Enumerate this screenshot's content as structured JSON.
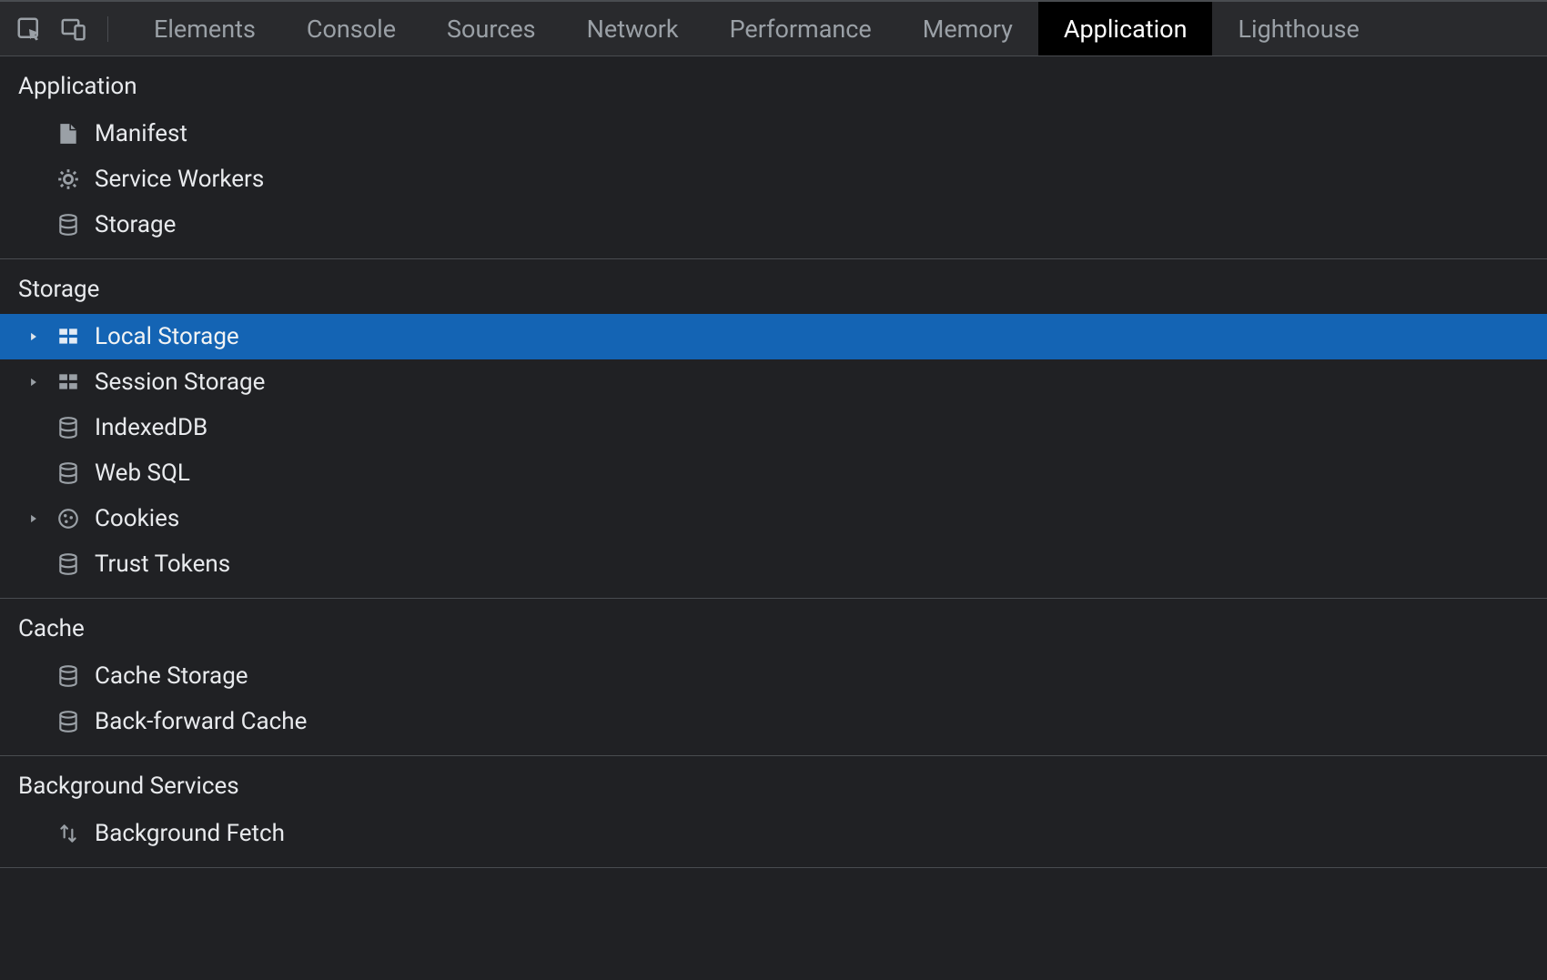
{
  "tabs": [
    {
      "id": "elements",
      "label": "Elements",
      "active": false
    },
    {
      "id": "console",
      "label": "Console",
      "active": false
    },
    {
      "id": "sources",
      "label": "Sources",
      "active": false
    },
    {
      "id": "network",
      "label": "Network",
      "active": false
    },
    {
      "id": "performance",
      "label": "Performance",
      "active": false
    },
    {
      "id": "memory",
      "label": "Memory",
      "active": false
    },
    {
      "id": "application",
      "label": "Application",
      "active": true
    },
    {
      "id": "lighthouse",
      "label": "Lighthouse",
      "active": false
    }
  ],
  "sections": [
    {
      "id": "application",
      "title": "Application",
      "items": [
        {
          "id": "manifest",
          "label": "Manifest",
          "icon": "file",
          "expandable": false,
          "selected": false
        },
        {
          "id": "service-workers",
          "label": "Service Workers",
          "icon": "gear",
          "expandable": false,
          "selected": false
        },
        {
          "id": "storage",
          "label": "Storage",
          "icon": "database",
          "expandable": false,
          "selected": false
        }
      ]
    },
    {
      "id": "storage",
      "title": "Storage",
      "items": [
        {
          "id": "local-storage",
          "label": "Local Storage",
          "icon": "grid",
          "expandable": true,
          "selected": true
        },
        {
          "id": "session-storage",
          "label": "Session Storage",
          "icon": "grid",
          "expandable": true,
          "selected": false
        },
        {
          "id": "indexeddb",
          "label": "IndexedDB",
          "icon": "database",
          "expandable": false,
          "selected": false
        },
        {
          "id": "websql",
          "label": "Web SQL",
          "icon": "database",
          "expandable": false,
          "selected": false
        },
        {
          "id": "cookies",
          "label": "Cookies",
          "icon": "cookie",
          "expandable": true,
          "selected": false
        },
        {
          "id": "trust-tokens",
          "label": "Trust Tokens",
          "icon": "database",
          "expandable": false,
          "selected": false
        }
      ]
    },
    {
      "id": "cache",
      "title": "Cache",
      "items": [
        {
          "id": "cache-storage",
          "label": "Cache Storage",
          "icon": "database",
          "expandable": false,
          "selected": false
        },
        {
          "id": "bf-cache",
          "label": "Back-forward Cache",
          "icon": "database",
          "expandable": false,
          "selected": false
        }
      ]
    },
    {
      "id": "background-services",
      "title": "Background Services",
      "items": [
        {
          "id": "background-fetch",
          "label": "Background Fetch",
          "icon": "updown",
          "expandable": false,
          "selected": false
        }
      ]
    }
  ]
}
